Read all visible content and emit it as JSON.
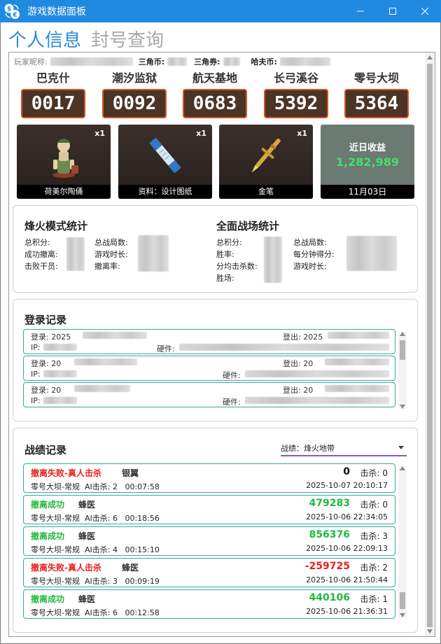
{
  "window": {
    "title": "游戏数据面板"
  },
  "tabs": [
    {
      "label": "个人信息",
      "active": true
    },
    {
      "label": "封号查询",
      "active": false
    }
  ],
  "player": {
    "nickname_label": "玩家昵称:",
    "currencies": [
      {
        "label": "三角币:"
      },
      {
        "label": "三角券:"
      },
      {
        "label": "哈夫币:"
      }
    ]
  },
  "maps": [
    {
      "name": "巴克什",
      "code": "0017"
    },
    {
      "name": "潮汐监狱",
      "code": "0092"
    },
    {
      "name": "航天基地",
      "code": "0683"
    },
    {
      "name": "长弓溪谷",
      "code": "5392"
    },
    {
      "name": "零号大坝",
      "code": "5364"
    }
  ],
  "items": [
    {
      "name": "荷美尔陶俑",
      "qty": "x1",
      "icon": "figurine-icon"
    },
    {
      "name": "资料：设计图纸",
      "qty": "x1",
      "icon": "blueprint-icon"
    },
    {
      "name": "金笔",
      "qty": "x1",
      "icon": "golden-pen-icon"
    }
  ],
  "income": {
    "title": "近日收益",
    "value": "1,282,989",
    "date": "11月03日"
  },
  "fire_stats": {
    "title": "烽火模式统计",
    "left_labels": [
      "总积分:",
      "成功撤离:",
      "击败干员:"
    ],
    "right_labels": [
      "总战局数:",
      "游戏时长:",
      "撤离率:"
    ]
  },
  "war_stats": {
    "title": "全面战场统计",
    "left_labels": [
      "总积分:",
      "胜率:",
      "分均击杀数:",
      "胜场:"
    ],
    "right_labels": [
      "总战局数:",
      "每分钟得分:",
      "游戏时长:"
    ]
  },
  "login": {
    "title": "登录记录",
    "entries": [
      {
        "login": "登录: 2025",
        "logout": "登出: 2025",
        "ip": "IP:",
        "hw": "硬件:"
      },
      {
        "login": "登录: 20",
        "logout": "登出: 20",
        "ip": "IP:",
        "hw": "硬件:"
      },
      {
        "login": "登录: 20",
        "logout": "登出: 20",
        "ip": "IP:",
        "hw": "硬件:"
      }
    ]
  },
  "records": {
    "title": "战绩记录",
    "filter_value": "战绩：烽火地带",
    "kills_label": "击杀:",
    "ai_label": "AI击杀:",
    "list": [
      {
        "status": "撤离失败-真人击杀",
        "result": "fail",
        "agent": "银翼",
        "score": "0",
        "score_color": "#111111",
        "kills": "0",
        "map": "零号大坝-常规",
        "ai_kills": "2",
        "duration": "00:07:58",
        "time": "2025-10-07 20:10:17"
      },
      {
        "status": "撤离成功",
        "result": "ok",
        "agent": "蜂医",
        "score": "479283",
        "score_color": "#20b93e",
        "kills": "0",
        "map": "零号大坝-常规",
        "ai_kills": "6",
        "duration": "00:18:56",
        "time": "2025-10-06 22:34:05"
      },
      {
        "status": "撤离成功",
        "result": "ok",
        "agent": "蜂医",
        "score": "856376",
        "score_color": "#20b93e",
        "kills": "3",
        "map": "零号大坝-常规",
        "ai_kills": "4",
        "duration": "00:15:10",
        "time": "2025-10-06 22:09:13"
      },
      {
        "status": "撤离失败-真人击杀",
        "result": "fail",
        "agent": "蜂医",
        "score": "-259725",
        "score_color": "#e62020",
        "kills": "2",
        "map": "零号大坝-常规",
        "ai_kills": "3",
        "duration": "00:09:19",
        "time": "2025-10-06 21:50:44"
      },
      {
        "status": "撤离成功",
        "result": "ok",
        "agent": "蜂医",
        "score": "440106",
        "score_color": "#20b93e",
        "kills": "1",
        "map": "零号大坝-常规",
        "ai_kills": "6",
        "duration": "00:12:58",
        "time": "2025-10-06 21:36:31"
      }
    ]
  },
  "colors": {
    "titlebar": "#1f8ae0",
    "accent": "#2a8ad6",
    "card_border": "#38a99b",
    "map_border": "#d8551f",
    "success": "#20b93e",
    "fail": "#e62020"
  }
}
